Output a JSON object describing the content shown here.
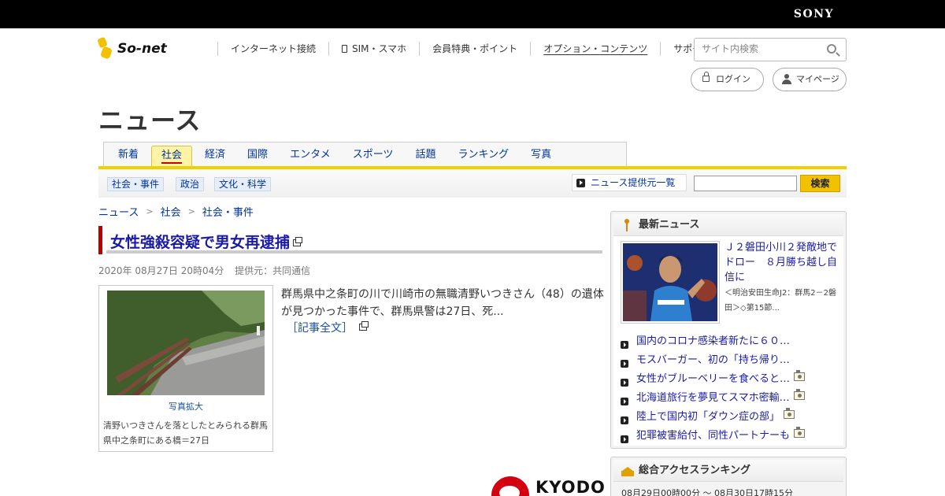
{
  "brand": {
    "sony": "SONY",
    "logo": "So-net"
  },
  "global_nav": {
    "items": [
      "インターネット接続",
      "SIM・スマホ",
      "会員特典・ポイント",
      "オプション・コンテンツ",
      "サポート"
    ],
    "current_index": 3
  },
  "site_search": {
    "placeholder": "サイト内検索"
  },
  "account": {
    "login": "ログイン",
    "mypage": "マイページ"
  },
  "section_title": "ニュース",
  "category_tabs": [
    "新着",
    "社会",
    "経済",
    "国際",
    "エンタメ",
    "スポーツ",
    "話題",
    "ランキング",
    "写真"
  ],
  "active_category_index": 1,
  "sub_categories": [
    "社会・事件",
    "政治",
    "文化・科学"
  ],
  "provider_list_link": "ニュース提供元一覧",
  "news_search": {
    "button": "検索",
    "value": ""
  },
  "breadcrumb": [
    "ニュース",
    "社会",
    "社会・事件"
  ],
  "article": {
    "title": "女性強殺容疑で男女再逮捕",
    "date": "2020年 08月27日 20時04分",
    "provider": "提供元：共同通信",
    "photo_link": "写真拡大",
    "photo_caption": "清野いつきさんを落としたとみられる群馬県中之条町にある橋＝27日",
    "body": "群馬県中之条町の川で川崎市の無職清野いつきさん（48）の遺体が見つかった事件で、群馬県警は27日、死...",
    "more": "［記事全文］",
    "provider_logo": "KYODO"
  },
  "latest_news": {
    "heading": "最新ニュース",
    "feature": {
      "title": "Ｊ２磐田小川２発敵地でドロー　８月勝ち越し自信に",
      "sub": "＜明治安田生命J2：群馬2－2磐田＞◇第15節..."
    },
    "items": [
      {
        "text": "国内のコロナ感染者新たに６０…",
        "photo": false
      },
      {
        "text": "モスバーガー、初の「持ち帰り…",
        "photo": false
      },
      {
        "text": "女性がブルーベリーを食べると…",
        "photo": true
      },
      {
        "text": "北海道旅行を夢見てスマホ密輸…",
        "photo": true
      },
      {
        "text": "陸上で国内初「ダウン症の部」",
        "photo": true
      },
      {
        "text": "犯罪被害給付、同性パートナーも",
        "photo": true
      }
    ]
  },
  "ranking": {
    "heading": "総合アクセスランキング",
    "range": "08月29日00時00分 ～ 08月30日17時15分"
  },
  "colors": {
    "accent_yellow": "#f2d000",
    "title_red_bar": "#bb0000",
    "link_blue": "#1a1aa6",
    "sony_bar": "#000000"
  }
}
